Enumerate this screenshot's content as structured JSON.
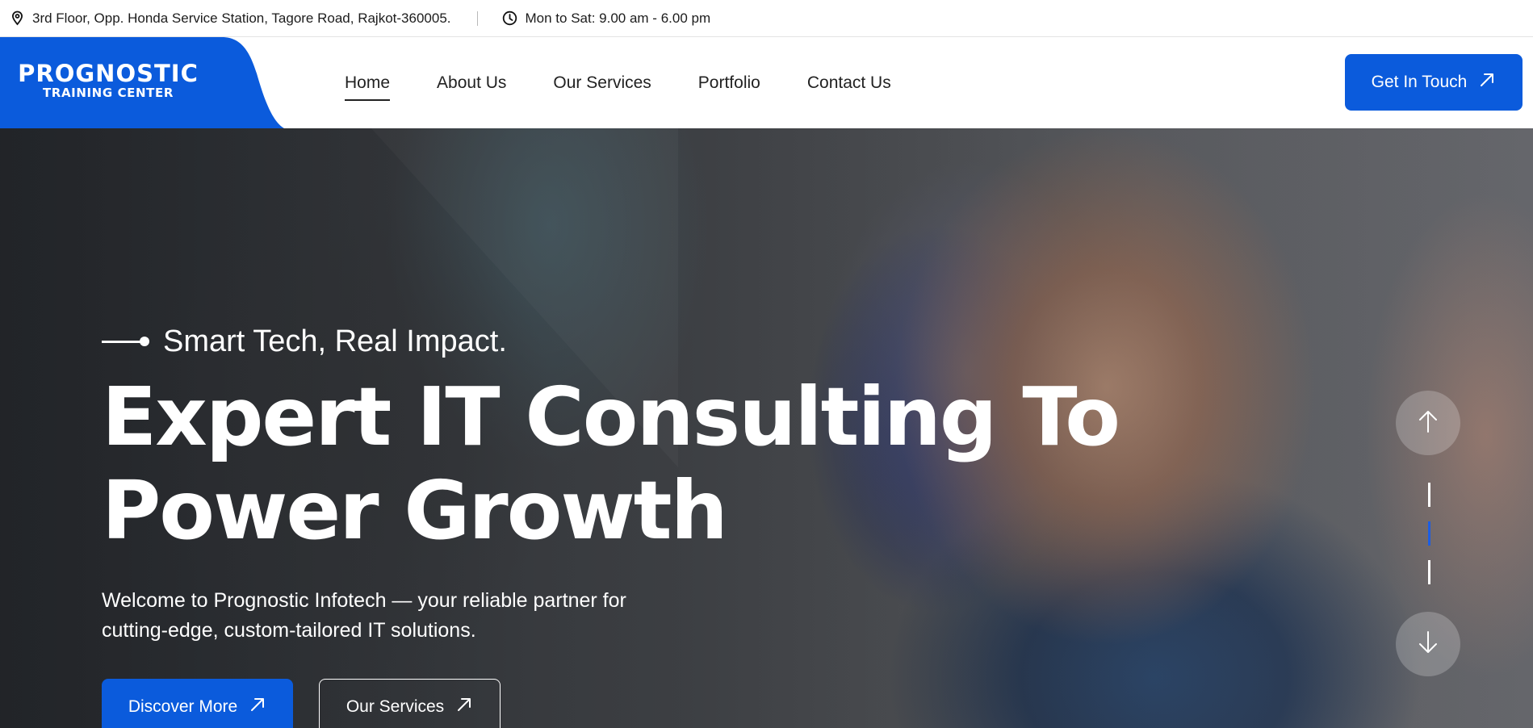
{
  "topbar": {
    "address": "3rd Floor, Opp. Honda Service Station, Tagore Road, Rajkot-360005.",
    "hours": "Mon to Sat: 9.00 am - 6.00 pm"
  },
  "logo": {
    "main": "PROGNOSTIC",
    "sub": "TRAINING CENTER"
  },
  "nav": {
    "items": [
      {
        "label": "Home",
        "active": true
      },
      {
        "label": "About Us",
        "active": false
      },
      {
        "label": "Our Services",
        "active": false
      },
      {
        "label": "Portfolio",
        "active": false
      },
      {
        "label": "Contact Us",
        "active": false
      }
    ],
    "cta_label": "Get In Touch"
  },
  "hero": {
    "tagline": "Smart Tech, Real Impact.",
    "headline_line1": "Expert IT Consulting To",
    "headline_line2": "Power Growth",
    "subtext_line1": "Welcome to Prognostic Infotech — your reliable partner for",
    "subtext_line2": "cutting-edge, custom-tailored IT solutions.",
    "primary_button": "Discover More",
    "secondary_button": "Our Services",
    "slider": {
      "up_icon": "arrow-up-icon",
      "down_icon": "arrow-down-icon",
      "slide_count": 3,
      "active_slide": 2
    }
  },
  "colors": {
    "brand_blue": "#0b5bdc",
    "indicator_active": "#1d5ee3"
  }
}
